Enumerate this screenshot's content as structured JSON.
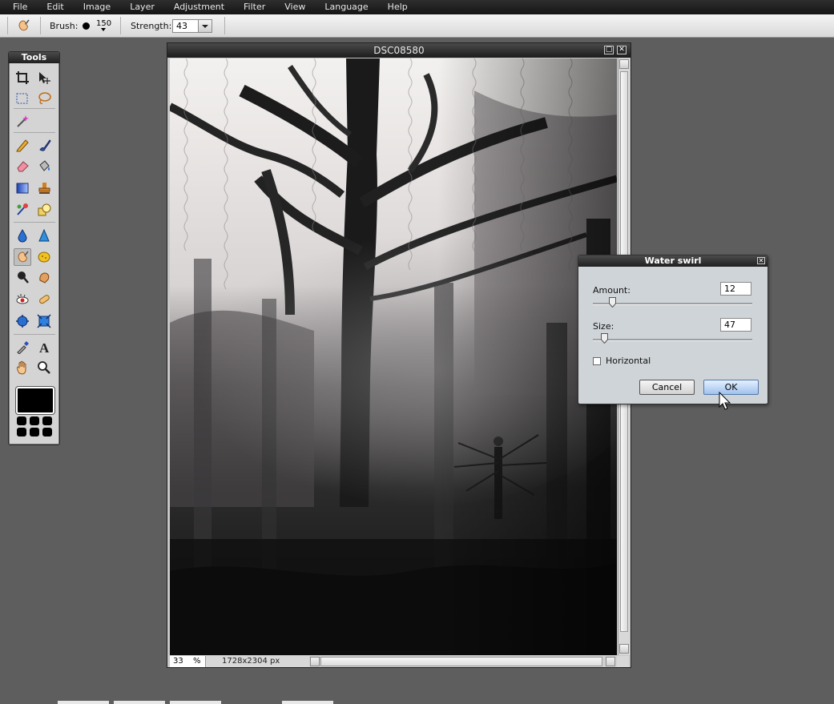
{
  "menubar": {
    "items": [
      "File",
      "Edit",
      "Image",
      "Layer",
      "Adjustment",
      "Filter",
      "View",
      "Language",
      "Help"
    ]
  },
  "options": {
    "brush_label": "Brush:",
    "brush_size": "150",
    "strength_label": "Strength:",
    "strength_value": "43"
  },
  "tools": {
    "title": "Tools",
    "icons": [
      "crop-icon",
      "move-icon",
      "marquee-select-icon",
      "lasso-icon",
      "magic-wand-icon",
      "pencil-icon",
      "brush-icon",
      "eraser-icon",
      "paint-bucket-icon",
      "gradient-icon",
      "clone-stamp-icon",
      "color-replace-icon",
      "drawing-shape-icon",
      "blur-icon",
      "sharpen-icon",
      "smudge-icon",
      "sponge-icon",
      "dodge-icon",
      "burn-icon",
      "red-eye-icon",
      "spot-heal-icon",
      "bloat-icon",
      "pinch-icon",
      "color-picker-icon",
      "type-icon",
      "hand-icon",
      "zoom-icon"
    ],
    "active_tool": "smudge-icon",
    "primary_color": "#000000"
  },
  "document": {
    "title": "DSC08580",
    "zoom": "33",
    "zoom_unit": "%",
    "dimensions": "1728x2304 px"
  },
  "dialog": {
    "title": "Water swirl",
    "amount_label": "Amount:",
    "amount_value": "12",
    "amount_fraction": 0.12,
    "size_label": "Size:",
    "size_value": "47",
    "size_fraction": 0.07,
    "horizontal_label": "Horizontal",
    "horizontal_checked": false,
    "cancel_label": "Cancel",
    "ok_label": "OK"
  },
  "colors": {
    "accent_button": "#9fc2ee",
    "chrome_dark": "#1c1c1c",
    "workspace": "#5e5e5e"
  }
}
